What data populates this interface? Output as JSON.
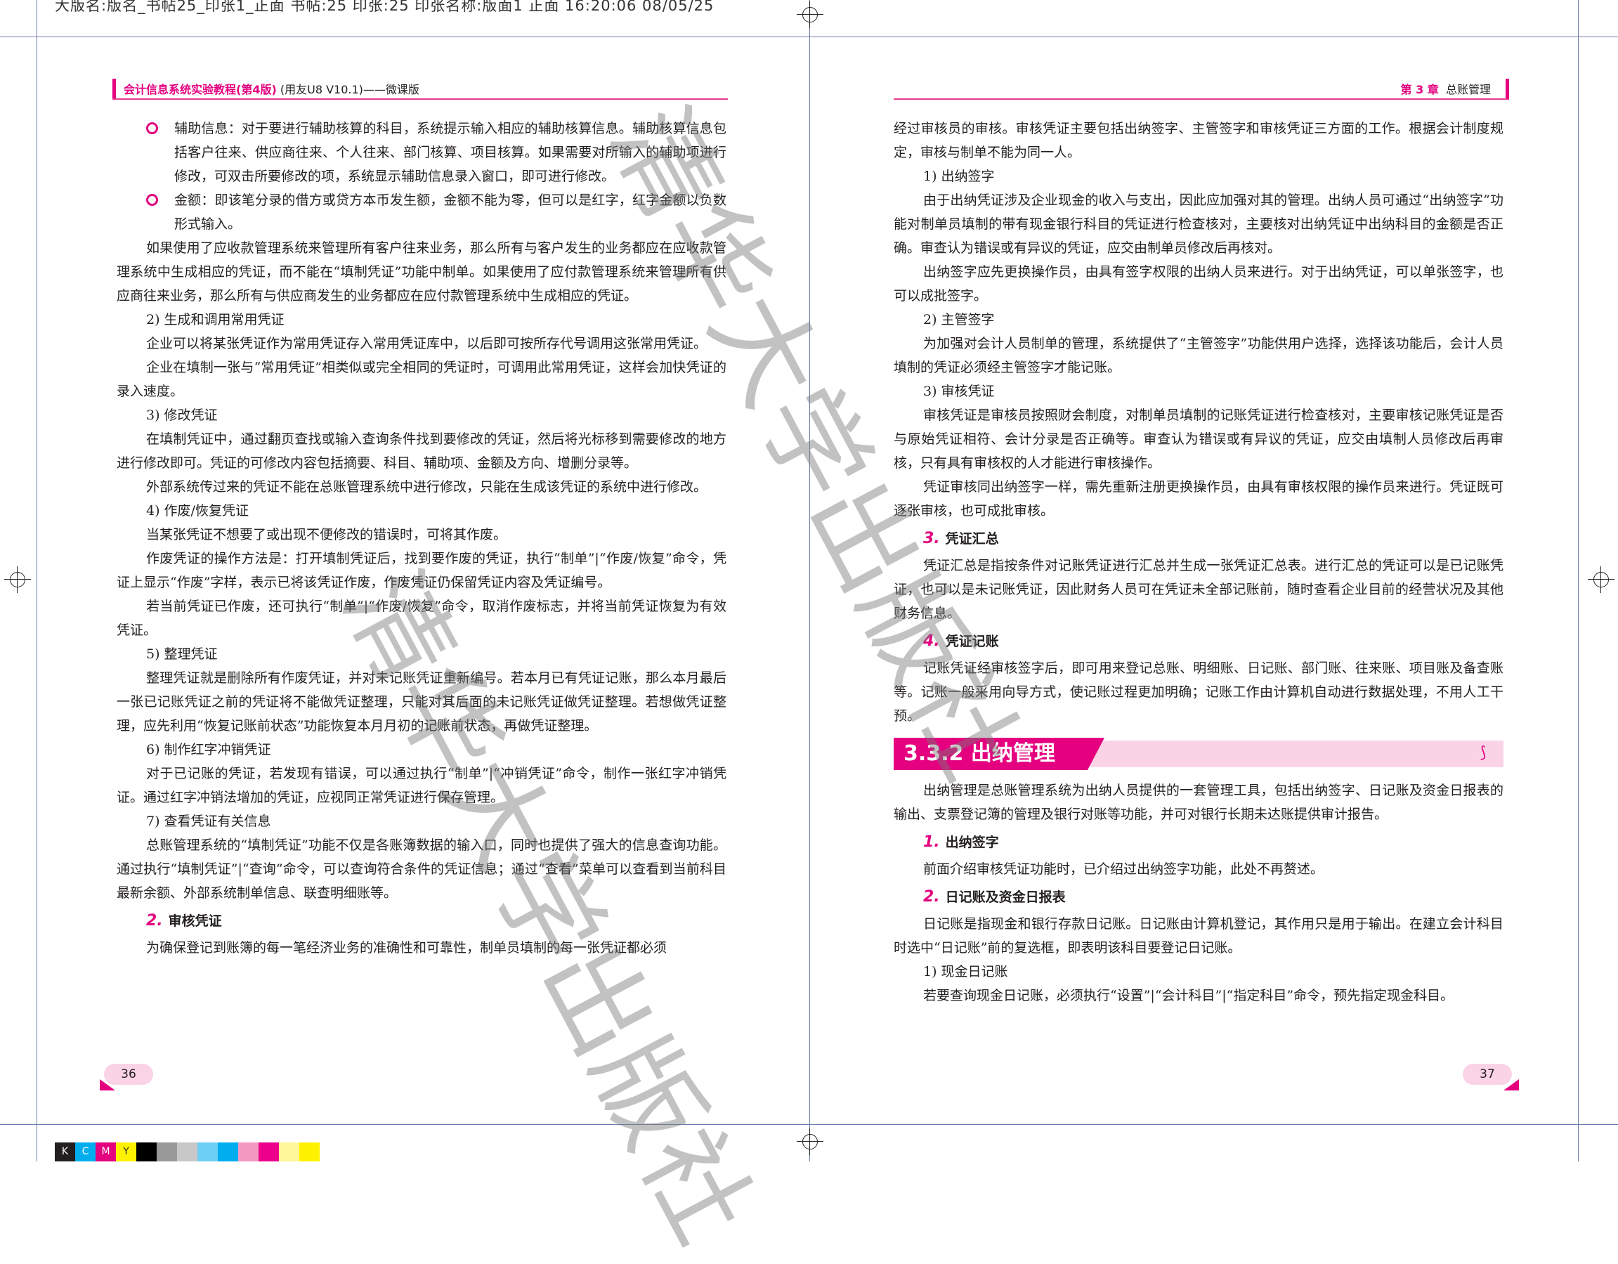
{
  "slug_line": "大版名:版名_书帖25_印张1_正面 书帖:25 印张:25 印张名称:版面1 正面 16:20:06 08/05/25",
  "watermark_text": "清华大学出版社",
  "left_page": {
    "header": {
      "book_title": "会计信息系统实验教程",
      "edition": "(第4版)",
      "subtitle": "(用友U8 V10.1)——微课版"
    },
    "page_number": "36",
    "bullets": [
      "辅助信息：对于要进行辅助核算的科目，系统提示输入相应的辅助核算信息。辅助核算信息包括客户往来、供应商往来、个人往来、部门核算、项目核算。如果需要对所输入的辅助项进行修改，可双击所要修改的项，系统显示辅助信息录入窗口，即可进行修改。",
      "金额：即该笔分录的借方或贷方本币发生额，金额不能为零，但可以是红字，红字金额以负数形式输入。"
    ],
    "p1": "如果使用了应收款管理系统来管理所有客户往来业务，那么所有与客户发生的业务都应在应收款管理系统中生成相应的凭证，而不能在“填制凭证”功能中制单。如果使用了应付款管理系统来管理所有供应商往来业务，那么所有与供应商发生的业务都应在应付款管理系统中生成相应的凭证。",
    "s2": "2) 生成和调用常用凭证",
    "p2": "企业可以将某张凭证作为常用凭证存入常用凭证库中，以后即可按所存代号调用这张常用凭证。",
    "p3": "企业在填制一张与“常用凭证”相类似或完全相同的凭证时，可调用此常用凭证，这样会加快凭证的录入速度。",
    "s3": "3) 修改凭证",
    "p4": "在填制凭证中，通过翻页查找或输入查询条件找到要修改的凭证，然后将光标移到需要修改的地方进行修改即可。凭证的可修改内容包括摘要、科目、辅助项、金额及方向、增删分录等。",
    "p5": "外部系统传过来的凭证不能在总账管理系统中进行修改，只能在生成该凭证的系统中进行修改。",
    "s4": "4) 作废/恢复凭证",
    "p6": "当某张凭证不想要了或出现不便修改的错误时，可将其作废。",
    "p7": "作废凭证的操作方法是：打开填制凭证后，找到要作废的凭证，执行“制单”|“作废/恢复”命令，凭证上显示“作废”字样，表示已将该凭证作废，作废凭证仍保留凭证内容及凭证编号。",
    "p8": "若当前凭证已作废，还可执行“制单”|“作废/恢复”命令，取消作废标志，并将当前凭证恢复为有效凭证。",
    "s5": "5) 整理凭证",
    "p9": "整理凭证就是删除所有作废凭证，并对未记账凭证重新编号。若本月已有凭证记账，那么本月最后一张已记账凭证之前的凭证将不能做凭证整理，只能对其后面的未记账凭证做凭证整理。若想做凭证整理，应先利用“恢复记账前状态”功能恢复本月月初的记账前状态，再做凭证整理。",
    "s6": "6) 制作红字冲销凭证",
    "p10": "对于已记账的凭证，若发现有错误，可以通过执行“制单”|“冲销凭证”命令，制作一张红字冲销凭证。通过红字冲销法增加的凭证，应视同正常凭证进行保存管理。",
    "s7": "7) 查看凭证有关信息",
    "p11": "总账管理系统的“填制凭证”功能不仅是各账簿数据的输入口，同时也提供了强大的信息查询功能。通过执行“填制凭证”|“查询”命令，可以查询符合条件的凭证信息；通过“查看”菜单可以查看到当前科目最新余额、外部系统制单信息、联查明细账等。",
    "h2_num": "2.",
    "h2_title": "审核凭证",
    "p12": "为确保登记到账簿的每一笔经济业务的准确性和可靠性，制单员填制的每一张凭证都必须"
  },
  "right_page": {
    "header": {
      "chapter": "第 3 章",
      "title": "总账管理"
    },
    "page_number": "37",
    "p1": "经过审核员的审核。审核凭证主要包括出纳签字、主管签字和审核凭证三方面的工作。根据会计制度规定，审核与制单不能为同一人。",
    "s1": "1) 出纳签字",
    "p2": "由于出纳凭证涉及企业现金的收入与支出，因此应加强对其的管理。出纳人员可通过“出纳签字”功能对制单员填制的带有现金银行科目的凭证进行检查核对，主要核对出纳凭证中出纳科目的金额是否正确。审查认为错误或有异议的凭证，应交由制单员修改后再核对。",
    "p3": "出纳签字应先更换操作员，由具有签字权限的出纳人员来进行。对于出纳凭证，可以单张签字，也可以成批签字。",
    "s2": "2) 主管签字",
    "p4": "为加强对会计人员制单的管理，系统提供了“主管签字”功能供用户选择，选择该功能后，会计人员填制的凭证必须经主管签字才能记账。",
    "s3": "3) 审核凭证",
    "p5": "审核凭证是审核员按照财会制度，对制单员填制的记账凭证进行检查核对，主要审核记账凭证是否与原始凭证相符、会计分录是否正确等。审查认为错误或有异议的凭证，应交由填制人员修改后再审核，只有具有审核权的人才能进行审核操作。",
    "p6": "凭证审核同出纳签字一样，需先重新注册更换操作员，由具有审核权限的操作员来进行。凭证既可逐张审核，也可成批审核。",
    "h3_num": "3.",
    "h3_title": "凭证汇总",
    "p7": "凭证汇总是指按条件对记账凭证进行汇总并生成一张凭证汇总表。进行汇总的凭证可以是已记账凭证，也可以是未记账凭证，因此财务人员可在凭证未全部记账前，随时查看企业目前的经营状况及其他财务信息。",
    "h4_num": "4.",
    "h4_title": "凭证记账",
    "p8": "记账凭证经审核签字后，即可用来登记总账、明细账、日记账、部门账、往来账、项目账及备查账等。记账一般采用向导方式，使记账过程更加明确；记账工作由计算机自动进行数据处理，不用人工干预。",
    "section_title": "3.3.2  出纳管理",
    "p9": "出纳管理是总账管理系统为出纳人员提供的一套管理工具，包括出纳签字、日记账及资金日报表的输出、支票登记簿的管理及银行对账等功能，并可对银行长期未达账提供审计报告。",
    "h5_num": "1.",
    "h5_title": "出纳签字",
    "p10": "前面介绍审核凭证功能时，已介绍过出纳签字功能，此处不再赘述。",
    "h6_num": "2.",
    "h6_title": "日记账及资金日报表",
    "p11": "日记账是指现金和银行存款日记账。日记账由计算机登记，其作用只是用于输出。在建立会计科目时选中“日记账”前的复选框，即表明该科目要登记日记账。",
    "s4": "1) 现金日记账",
    "p12": "若要查询现金日记账，必须执行“设置”|“会计科目”|“指定科目”命令，预先指定现金科目。"
  },
  "color_bar": [
    "K",
    "C",
    "M",
    "Y"
  ],
  "colors": {
    "accent": "#e4007f",
    "accent_light": "#fbd3e6",
    "rule": "#6b7bb3"
  }
}
